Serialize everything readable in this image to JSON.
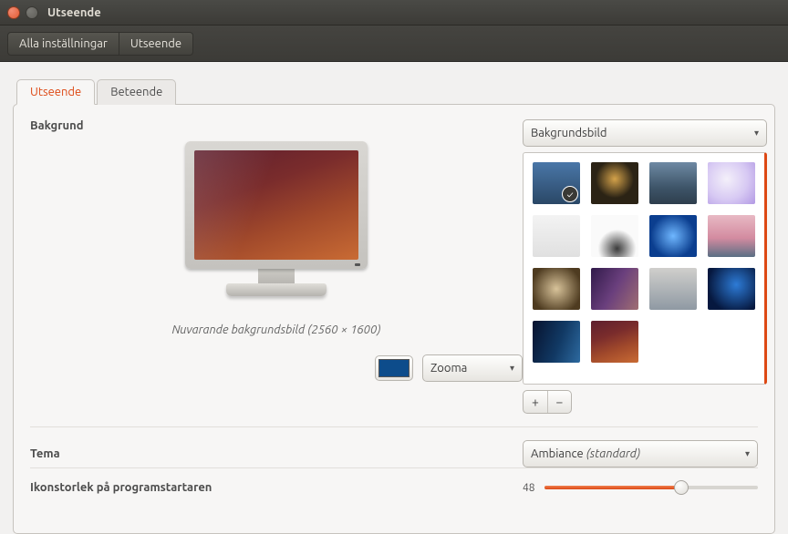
{
  "window": {
    "title": "Utseende"
  },
  "toolbar": {
    "all_settings": "Alla inställningar",
    "appearance": "Utseende"
  },
  "tabs": {
    "look": "Utseende",
    "behavior": "Beteende"
  },
  "background": {
    "label": "Bakgrund",
    "caption": "Nuvarande bakgrundsbild (2560 × 1600)",
    "dropdown": "Bakgrundsbild",
    "zoom": "Zooma",
    "swatch_color": "#0d4c8b",
    "thumbs": [
      {
        "style": "linear-gradient(to bottom,#4a77a8,#2a4766)",
        "selected": true
      },
      {
        "style": "radial-gradient(circle at 50% 40%,#d4a24a 0%,#2b2315 55%)"
      },
      {
        "style": "linear-gradient(to bottom,#6e89a3 0%,#3e5569 60%,#2e3e4d 100%)"
      },
      {
        "style": "radial-gradient(circle at 40% 40%,#f4f0fa 0%,#d7c9f3 55%,#b299e4 100%)"
      },
      {
        "style": "linear-gradient(to bottom,#f3f3f3,#e0e0e0)"
      },
      {
        "style": "radial-gradient(circle at 55% 80%,#3a3a3a 0%,#fafafa 45%)"
      },
      {
        "style": "radial-gradient(circle at 50% 50%,#6fb7ff 0%,#0b3e8f 70%)"
      },
      {
        "style": "linear-gradient(to bottom,#e8b9c4 0%,#d38ba0 55%,#5a6f84 100%)"
      },
      {
        "style": "radial-gradient(circle at 50% 50%,#d8c39a 0%,#4e3b20 80%)"
      },
      {
        "style": "linear-gradient(120deg,#311a4a 0%,#6a3f7d 50%,#a06e72 100%)"
      },
      {
        "style": "linear-gradient(to bottom,#d0cfcc 0%,#8f99a3 100%)"
      },
      {
        "style": "radial-gradient(circle at 60% 40%,#2d7bd6 0%,#06183f 75%)"
      },
      {
        "style": "linear-gradient(110deg,#07122e 0%,#113964 55%,#2d6aa0 100%)"
      },
      {
        "style": "linear-gradient(160deg,#5e1f2e 0%,#7a2c2c 35%,#a24a2b 65%,#c96b34 100%)"
      }
    ]
  },
  "theme": {
    "label": "Tema",
    "value": "Ambiance",
    "suffix": "(standard)"
  },
  "icon_size": {
    "label": "Ikonstorlek på programstartaren",
    "value": "48"
  }
}
